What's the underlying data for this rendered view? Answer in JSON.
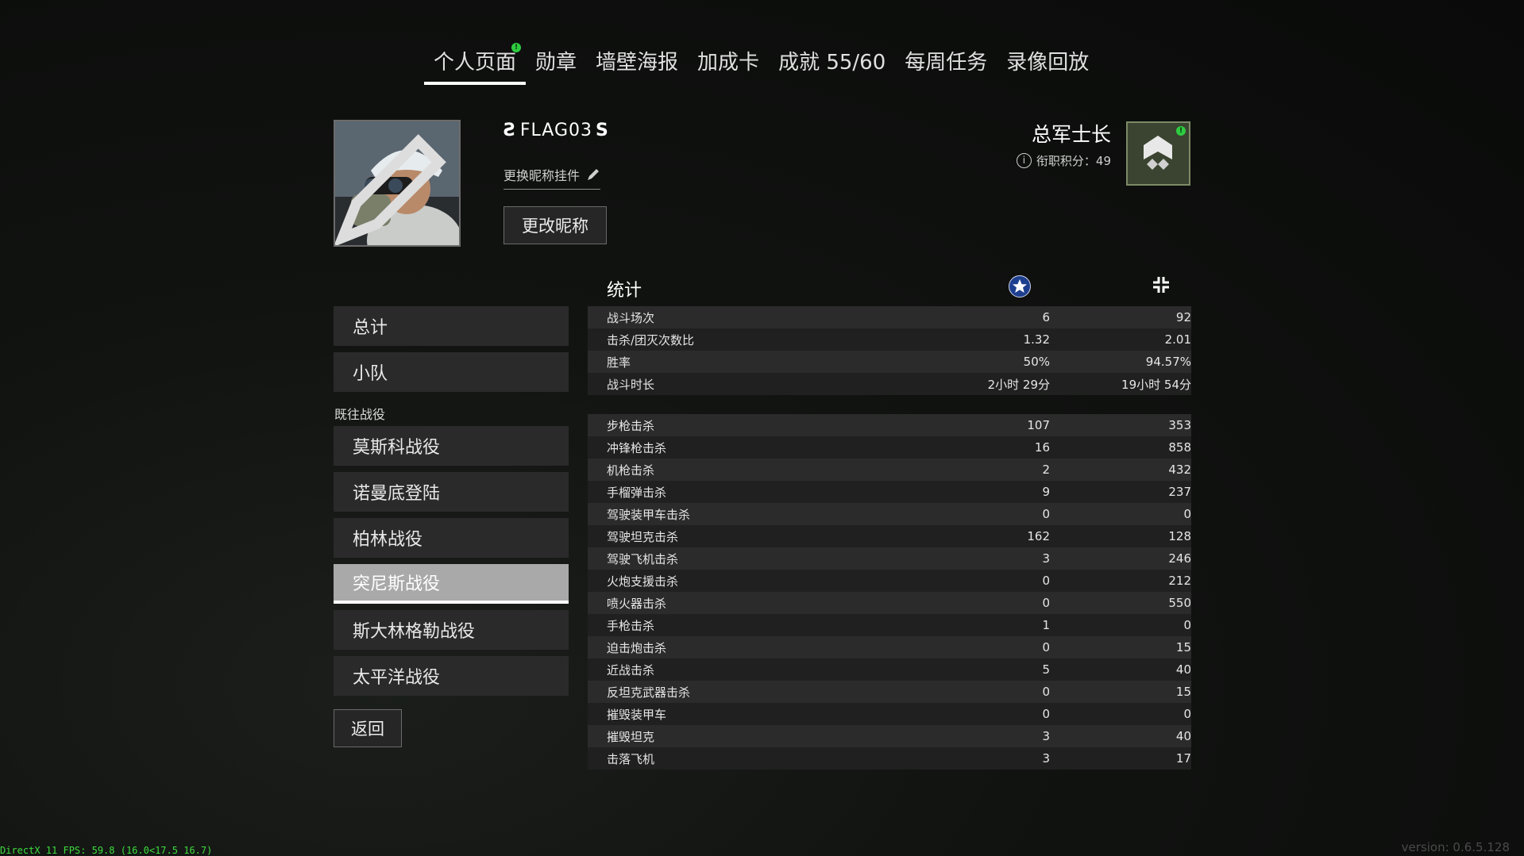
{
  "tabs": [
    {
      "label": "个人页面",
      "active": true,
      "notification": "!"
    },
    {
      "label": "勋章"
    },
    {
      "label": "墙壁海报"
    },
    {
      "label": "加成卡"
    },
    {
      "label": "成就 55/60"
    },
    {
      "label": "每周任务"
    },
    {
      "label": "录像回放"
    }
  ],
  "profile": {
    "gamertag_prefix": "Ƨ",
    "gamertag": "FLAG03",
    "gamertag_suffix": "S",
    "change_plate_label": "更换昵称挂件",
    "rename_button": "更改昵称"
  },
  "rank": {
    "title": "总军士长",
    "points_label": "衔职积分：49",
    "badge_notification": "!"
  },
  "menu": {
    "top_items": [
      "总计",
      "小队"
    ],
    "section_label": "既往战役",
    "campaigns": [
      "莫斯科战役",
      "诺曼底登陆",
      "柏林战役",
      "突尼斯战役",
      "斯大林格勒战役",
      "太平洋战役"
    ],
    "selected_campaign": "突尼斯战役",
    "back_button": "返回"
  },
  "stats": {
    "title": "统计",
    "columns": [
      "allies-star-icon",
      "axis-cross-icon"
    ],
    "summary_rows": [
      {
        "label": "战斗场次",
        "allies": "6",
        "axis": "92"
      },
      {
        "label": "击杀/团灭次数比",
        "allies": "1.32",
        "axis": "2.01"
      },
      {
        "label": "胜率",
        "allies": "50%",
        "axis": "94.57%"
      },
      {
        "label": "战斗时长",
        "allies": "2小时 29分",
        "axis": "19小时 54分"
      }
    ],
    "kill_rows": [
      {
        "label": "步枪击杀",
        "allies": "107",
        "axis": "353"
      },
      {
        "label": "冲锋枪击杀",
        "allies": "16",
        "axis": "858"
      },
      {
        "label": "机枪击杀",
        "allies": "2",
        "axis": "432"
      },
      {
        "label": "手榴弹击杀",
        "allies": "9",
        "axis": "237"
      },
      {
        "label": "驾驶装甲车击杀",
        "allies": "0",
        "axis": "0"
      },
      {
        "label": "驾驶坦克击杀",
        "allies": "162",
        "axis": "128"
      },
      {
        "label": "驾驶飞机击杀",
        "allies": "3",
        "axis": "246"
      },
      {
        "label": "火炮支援击杀",
        "allies": "0",
        "axis": "212"
      },
      {
        "label": "喷火器击杀",
        "allies": "0",
        "axis": "550"
      },
      {
        "label": "手枪击杀",
        "allies": "1",
        "axis": "0"
      },
      {
        "label": "迫击炮击杀",
        "allies": "0",
        "axis": "15"
      },
      {
        "label": "近战击杀",
        "allies": "5",
        "axis": "40"
      },
      {
        "label": "反坦克武器击杀",
        "allies": "0",
        "axis": "15"
      },
      {
        "label": "摧毁装甲车",
        "allies": "0",
        "axis": "0"
      },
      {
        "label": "摧毁坦克",
        "allies": "3",
        "axis": "40"
      },
      {
        "label": "击落飞机",
        "allies": "3",
        "axis": "17"
      }
    ]
  },
  "footer": {
    "fps": "DirectX 11 FPS: 59.8 (16.0<17.5 16.7)",
    "version": "version: 0.6.5.128"
  }
}
